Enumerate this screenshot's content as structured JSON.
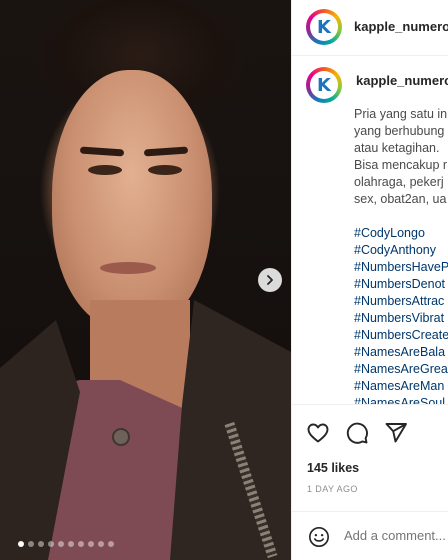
{
  "post": {
    "image_indicator": {
      "count": 10,
      "active_index": 0
    },
    "next_icon": "chevron-right-icon"
  },
  "header": {
    "avatar_letter": "K",
    "username": "kapple_numerol"
  },
  "caption": {
    "avatar_letter": "K",
    "username": "kapple_numerol",
    "text_lines": [
      "Pria yang satu in",
      "yang berhubung",
      "atau ketagihan.",
      "Bisa mencakup r",
      "olahraga, pekerj",
      "sex, obat2an, ua"
    ],
    "hashtags": [
      "#CodyLongo",
      "#CodyAnthony",
      "#NumbersHaveP",
      "#NumbersDenot",
      "#NumbersAttrac",
      "#NumbersVibrat",
      "#NumbersCreate",
      "#NamesAreBala",
      "#NamesAreGrea",
      "#NamesAreMan",
      "#NamesAreSoul"
    ]
  },
  "actions": {
    "like_icon": "heart-icon",
    "comment_icon": "comment-icon",
    "share_icon": "send-icon"
  },
  "likes": "145 likes",
  "time": "1 DAY AGO",
  "comment_box": {
    "emoji_icon": "smiley-icon",
    "placeholder": "Add a comment..."
  }
}
